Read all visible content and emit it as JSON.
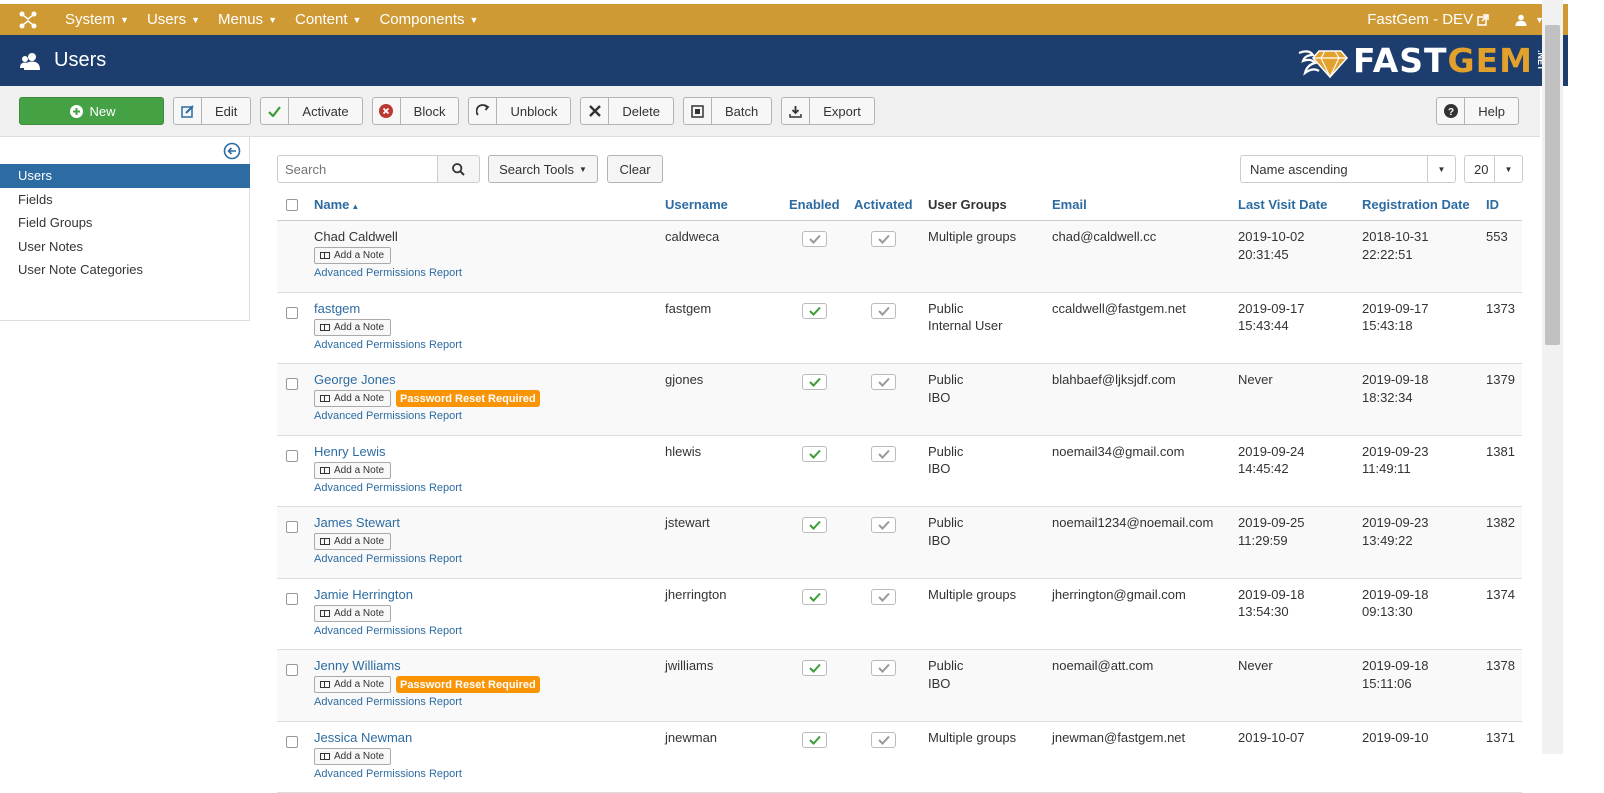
{
  "colors": {
    "topnav_bg": "#cf9a34",
    "header_bg": "#1c3d6e",
    "accent_blue": "#2d6ca2",
    "new_button_green": "#45a244",
    "badge_orange": "#f89406",
    "enabled_check_green": "#3c9c3a"
  },
  "topnav": {
    "logo_icon": "joomla-icon",
    "menu": [
      {
        "label": "System"
      },
      {
        "label": "Users"
      },
      {
        "label": "Menus"
      },
      {
        "label": "Content"
      },
      {
        "label": "Components"
      }
    ],
    "site_link": "FastGem - DEV",
    "user_icon": "user-icon"
  },
  "header": {
    "title": "Users",
    "brand_fast": "FAST",
    "brand_gem": "GEM",
    "brand_net": ".NET"
  },
  "toolbar": {
    "new": "New",
    "edit": "Edit",
    "activate": "Activate",
    "block": "Block",
    "unblock": "Unblock",
    "delete": "Delete",
    "batch": "Batch",
    "export": "Export",
    "help": "Help"
  },
  "sidebar": {
    "items": [
      {
        "label": "Users",
        "active": true
      },
      {
        "label": "Fields"
      },
      {
        "label": "Field Groups"
      },
      {
        "label": "User Notes"
      },
      {
        "label": "User Note Categories"
      }
    ]
  },
  "filters": {
    "search_placeholder": "Search",
    "search_tools": "Search Tools",
    "clear": "Clear",
    "sort": "Name ascending",
    "limit": "20"
  },
  "table": {
    "headers": {
      "name": "Name",
      "username": "Username",
      "enabled": "Enabled",
      "activated": "Activated",
      "groups": "User Groups",
      "email": "Email",
      "last_visit": "Last Visit Date",
      "registration": "Registration Date",
      "id": "ID"
    },
    "add_note_label": "Add a Note",
    "permissions_label": "Advanced Permissions Report",
    "password_reset_label": "Password Reset Required",
    "rows": [
      {
        "name": "Chad Caldwell",
        "username": "caldweca",
        "enabled": true,
        "activated": true,
        "groups": [
          "Multiple groups"
        ],
        "email": "chad@caldwell.cc",
        "last_visit": [
          "2019-10-02",
          "20:31:45"
        ],
        "registered": [
          "2018-10-31",
          "22:22:51"
        ],
        "id": "553",
        "password_reset": false,
        "self": true
      },
      {
        "name": "fastgem",
        "username": "fastgem",
        "enabled": true,
        "activated": true,
        "groups": [
          "Public",
          "Internal User"
        ],
        "email": "ccaldwell@fastgem.net",
        "last_visit": [
          "2019-09-17",
          "15:43:44"
        ],
        "registered": [
          "2019-09-17",
          "15:43:18"
        ],
        "id": "1373",
        "password_reset": false
      },
      {
        "name": "George Jones",
        "username": "gjones",
        "enabled": true,
        "activated": true,
        "groups": [
          "Public",
          "IBO"
        ],
        "email": "blahbaef@ljksjdf.com",
        "last_visit": [
          "Never"
        ],
        "registered": [
          "2019-09-18",
          "18:32:34"
        ],
        "id": "1379",
        "password_reset": true
      },
      {
        "name": "Henry Lewis",
        "username": "hlewis",
        "enabled": true,
        "activated": true,
        "groups": [
          "Public",
          "IBO"
        ],
        "email": "noemail34@gmail.com",
        "last_visit": [
          "2019-09-24",
          "14:45:42"
        ],
        "registered": [
          "2019-09-23",
          "11:49:11"
        ],
        "id": "1381",
        "password_reset": false
      },
      {
        "name": "James Stewart",
        "username": "jstewart",
        "enabled": true,
        "activated": true,
        "groups": [
          "Public",
          "IBO"
        ],
        "email": "noemail1234@noemail.com",
        "last_visit": [
          "2019-09-25",
          "11:29:59"
        ],
        "registered": [
          "2019-09-23",
          "13:49:22"
        ],
        "id": "1382",
        "password_reset": false
      },
      {
        "name": "Jamie Herrington",
        "username": "jherrington",
        "enabled": true,
        "activated": true,
        "groups": [
          "Multiple groups"
        ],
        "email": "jherrington@gmail.com",
        "last_visit": [
          "2019-09-18",
          "13:54:30"
        ],
        "registered": [
          "2019-09-18",
          "09:13:30"
        ],
        "id": "1374",
        "password_reset": false
      },
      {
        "name": "Jenny Williams",
        "username": "jwilliams",
        "enabled": true,
        "activated": true,
        "groups": [
          "Public",
          "IBO"
        ],
        "email": "noemail@att.com",
        "last_visit": [
          "Never"
        ],
        "registered": [
          "2019-09-18",
          "15:11:06"
        ],
        "id": "1378",
        "password_reset": true
      },
      {
        "name": "Jessica Newman",
        "username": "jnewman",
        "enabled": true,
        "activated": true,
        "groups": [
          "Multiple groups"
        ],
        "email": "jnewman@fastgem.net",
        "last_visit": [
          "2019-10-07"
        ],
        "registered": [
          "2019-09-10"
        ],
        "id": "1371",
        "password_reset": false
      }
    ]
  }
}
